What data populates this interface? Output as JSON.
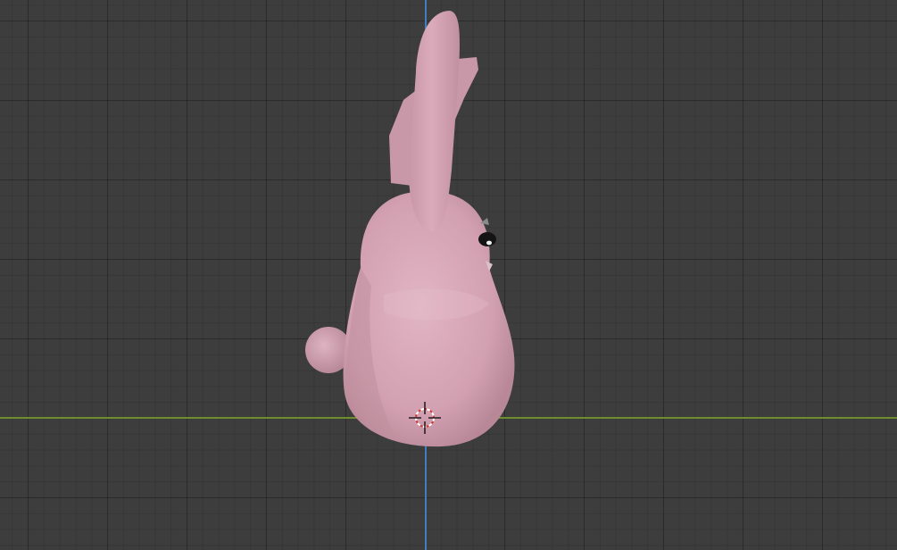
{
  "viewport": {
    "background": "#3d3d3d",
    "axis_x_color": "#6e8d2c",
    "axis_z_color": "#3f7fbf",
    "grid_color": "#2f2f2f"
  },
  "model": {
    "name_visible": "",
    "body_color": "#d3a2b3",
    "body_shadow": "#b98a9b",
    "body_highlight": "#e3b7c6",
    "eye_color": "#141414",
    "eye_highlight": "#f0f0f0"
  },
  "cursor": {
    "name": "3d-cursor-icon",
    "ring_color": "#d33a3a",
    "cross_color": "#ffffff"
  }
}
